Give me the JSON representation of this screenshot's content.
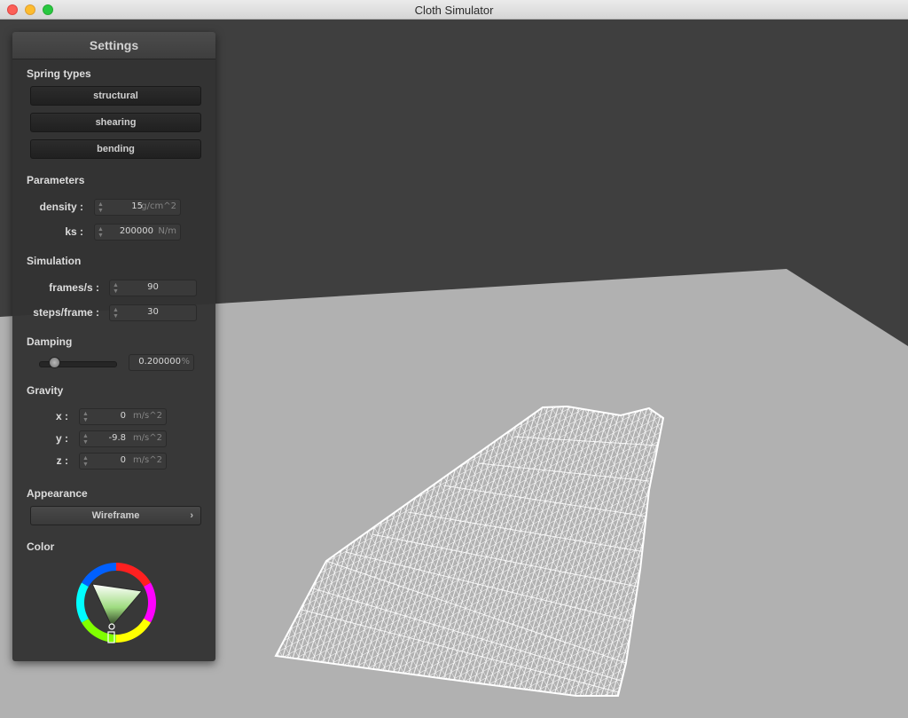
{
  "window": {
    "title": "Cloth Simulator"
  },
  "panel": {
    "title": "Settings",
    "spring_types": {
      "heading": "Spring types",
      "buttons": [
        "structural",
        "shearing",
        "bending"
      ]
    },
    "parameters": {
      "heading": "Parameters",
      "density": {
        "label": "density :",
        "value": "15",
        "unit": "g/cm^2"
      },
      "ks": {
        "label": "ks :",
        "value": "200000",
        "unit": "N/m"
      }
    },
    "simulation": {
      "heading": "Simulation",
      "frames": {
        "label": "frames/s :",
        "value": "90"
      },
      "steps": {
        "label": "steps/frame :",
        "value": "30"
      }
    },
    "damping": {
      "heading": "Damping",
      "value": "0.200000",
      "unit": "%",
      "level": 0.2
    },
    "gravity": {
      "heading": "Gravity",
      "x": {
        "label": "x :",
        "value": "0",
        "unit": "m/s^2"
      },
      "y": {
        "label": "y :",
        "value": "-9.8",
        "unit": "m/s^2"
      },
      "z": {
        "label": "z :",
        "value": "0",
        "unit": "m/s^2"
      }
    },
    "appearance": {
      "heading": "Appearance",
      "value": "Wireframe"
    },
    "color": {
      "heading": "Color",
      "selected": "#9fdc80"
    }
  },
  "scene": {
    "background": "#3f3f3f",
    "floor": "#b1b1b1",
    "cloth": "#ffffff",
    "render_mode": "wireframe"
  }
}
